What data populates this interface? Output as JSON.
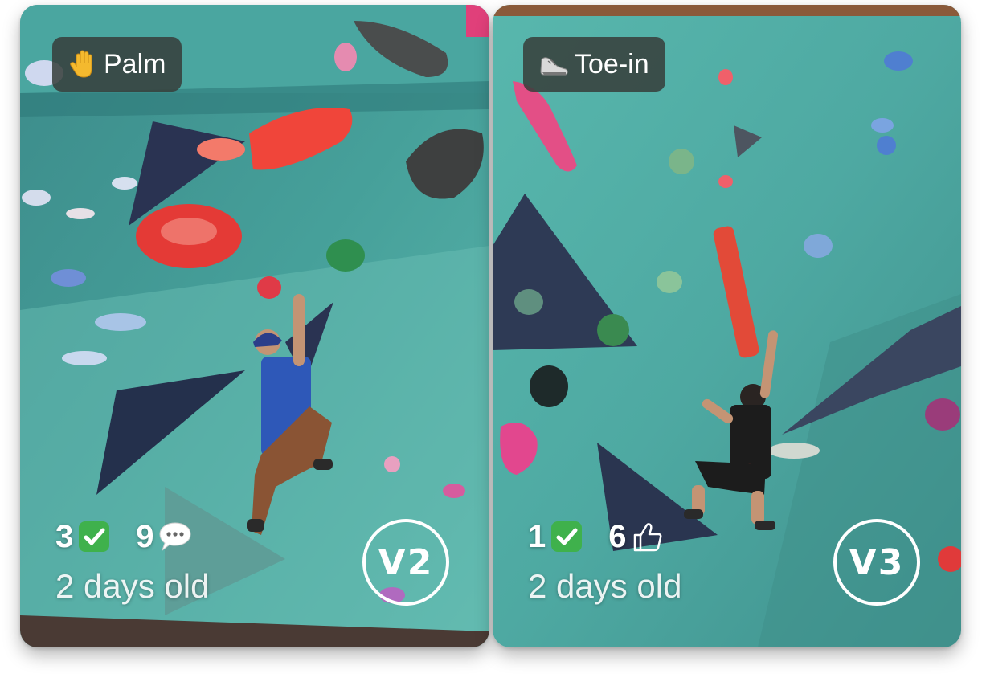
{
  "cards": [
    {
      "tag": {
        "label": "Palm",
        "icon": "raised-hand-icon"
      },
      "sends": {
        "count": "3",
        "icon": "check-mark-icon"
      },
      "second": {
        "count": "9",
        "icon": "speech-bubble-icon"
      },
      "age": "2 days old",
      "grade": "V2",
      "colors": {
        "wall": "#3f8f8c",
        "accent": "#e8453c"
      }
    },
    {
      "tag": {
        "label": "Toe-in",
        "icon": "shoe-icon"
      },
      "sends": {
        "count": "1",
        "icon": "check-mark-icon"
      },
      "second": {
        "count": "6",
        "icon": "thumbs-up-icon"
      },
      "age": "2 days old",
      "grade": "V3",
      "colors": {
        "wall": "#4fb0a8",
        "accent": "#e25a3a"
      }
    }
  ]
}
